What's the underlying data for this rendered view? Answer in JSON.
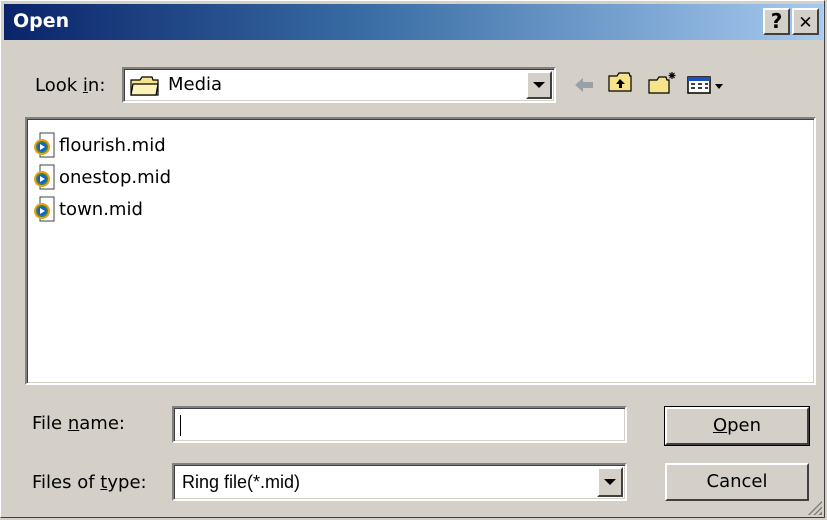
{
  "window": {
    "title": "Open",
    "help_button": "?",
    "close_button": "✕"
  },
  "look_in": {
    "label_pre": "Look ",
    "label_accel": "i",
    "label_post": "n:",
    "value": "Media",
    "icon": "folder-icon"
  },
  "toolbar": {
    "back_icon": "back-arrow-icon",
    "up_icon": "up-folder-icon",
    "new_folder_icon": "new-folder-icon",
    "view_menu_icon": "view-menu-icon"
  },
  "files": [
    {
      "name": "flourish.mid",
      "icon": "media-file-icon"
    },
    {
      "name": "onestop.mid",
      "icon": "media-file-icon"
    },
    {
      "name": "town.mid",
      "icon": "media-file-icon"
    }
  ],
  "file_name": {
    "label_pre": "File ",
    "label_accel": "n",
    "label_post": "ame:",
    "value": ""
  },
  "file_type": {
    "label_pre": "Files of ",
    "label_accel": "t",
    "label_post": "ype:",
    "value": "Ring file(*.mid)"
  },
  "buttons": {
    "open_accel": "O",
    "open_rest": "pen",
    "cancel": "Cancel"
  },
  "colors": {
    "title_start": "#0a246a",
    "title_end": "#a6caf0",
    "face": "#d4d0c8"
  }
}
